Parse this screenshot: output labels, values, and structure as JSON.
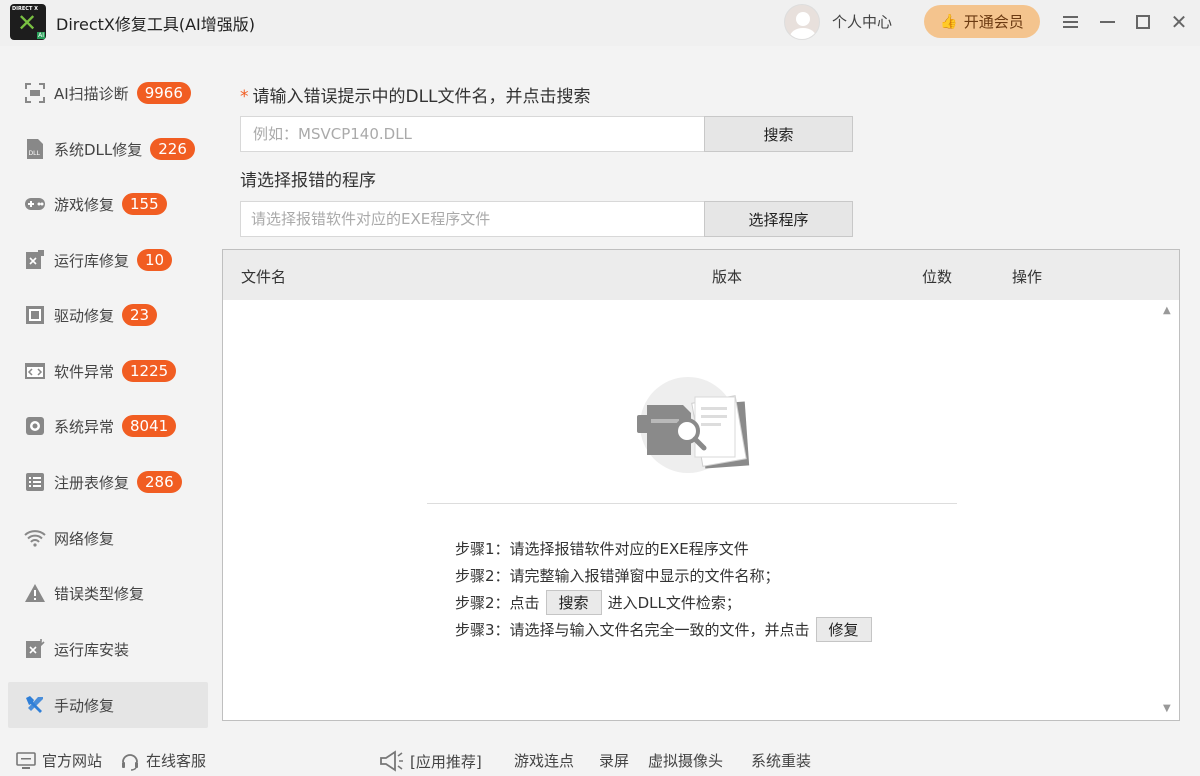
{
  "titlebar": {
    "app_title": "DirectX修复工具(AI增强版)",
    "logo_text": "DIRECT X",
    "logo_badge": "AI",
    "personal_center": "个人中心",
    "vip_button": "开通会员"
  },
  "sidebar": {
    "items": [
      {
        "label": "AI扫描诊断",
        "badge": "9966",
        "icon": "scan-icon"
      },
      {
        "label": "系统DLL修复",
        "badge": "226",
        "icon": "dll-file-icon"
      },
      {
        "label": "游戏修复",
        "badge": "155",
        "icon": "gamepad-icon"
      },
      {
        "label": "运行库修复",
        "badge": "10",
        "icon": "visual-studio-icon"
      },
      {
        "label": "驱动修复",
        "badge": "23",
        "icon": "driver-chip-icon"
      },
      {
        "label": "软件异常",
        "badge": "1225",
        "icon": "code-window-icon"
      },
      {
        "label": "系统异常",
        "badge": "8041",
        "icon": "gear-icon"
      },
      {
        "label": "注册表修复",
        "badge": "286",
        "icon": "list-icon"
      },
      {
        "label": "网络修复",
        "badge": "",
        "icon": "wifi-icon"
      },
      {
        "label": "错误类型修复",
        "badge": "",
        "icon": "warning-icon"
      },
      {
        "label": "运行库安装",
        "badge": "",
        "icon": "runtime-install-icon"
      },
      {
        "label": "手动修复",
        "badge": "",
        "icon": "wrench-icon",
        "active": true
      }
    ]
  },
  "main": {
    "dll_label_star": "*",
    "dll_label": "请输入错误提示中的DLL文件名，并点击搜索",
    "dll_placeholder": "例如：MSVCP140.DLL",
    "search_button": "搜索",
    "program_label": "请选择报错的程序",
    "program_placeholder": "请选择报错软件对应的EXE程序文件",
    "choose_button": "选择程序",
    "table": {
      "columns": [
        "文件名",
        "版本",
        "位数",
        "操作"
      ]
    },
    "steps": {
      "s1": "步骤1：请选择报错软件对应的EXE程序文件",
      "s2": "步骤2：请完整输入报错弹窗中显示的文件名称；",
      "s3_prefix": "步骤2：点击",
      "s3_button": "搜索",
      "s3_suffix": "进入DLL文件检索；",
      "s4_prefix": "步骤3：请选择与输入文件名完全一致的文件，并点击",
      "s4_button": "修复"
    }
  },
  "footer": {
    "website": "官方网站",
    "support": "在线客服",
    "recommend": "[应用推荐]",
    "links": [
      "游戏连点",
      "录屏",
      "虚拟摄像头",
      "系统重装"
    ]
  },
  "colors": {
    "badge": "#f15d22",
    "vip": "#f4c48e",
    "active_nav": "#e5e5e5",
    "icon_gray": "#8a8a8a",
    "icon_blue": "#2f7fd8"
  }
}
